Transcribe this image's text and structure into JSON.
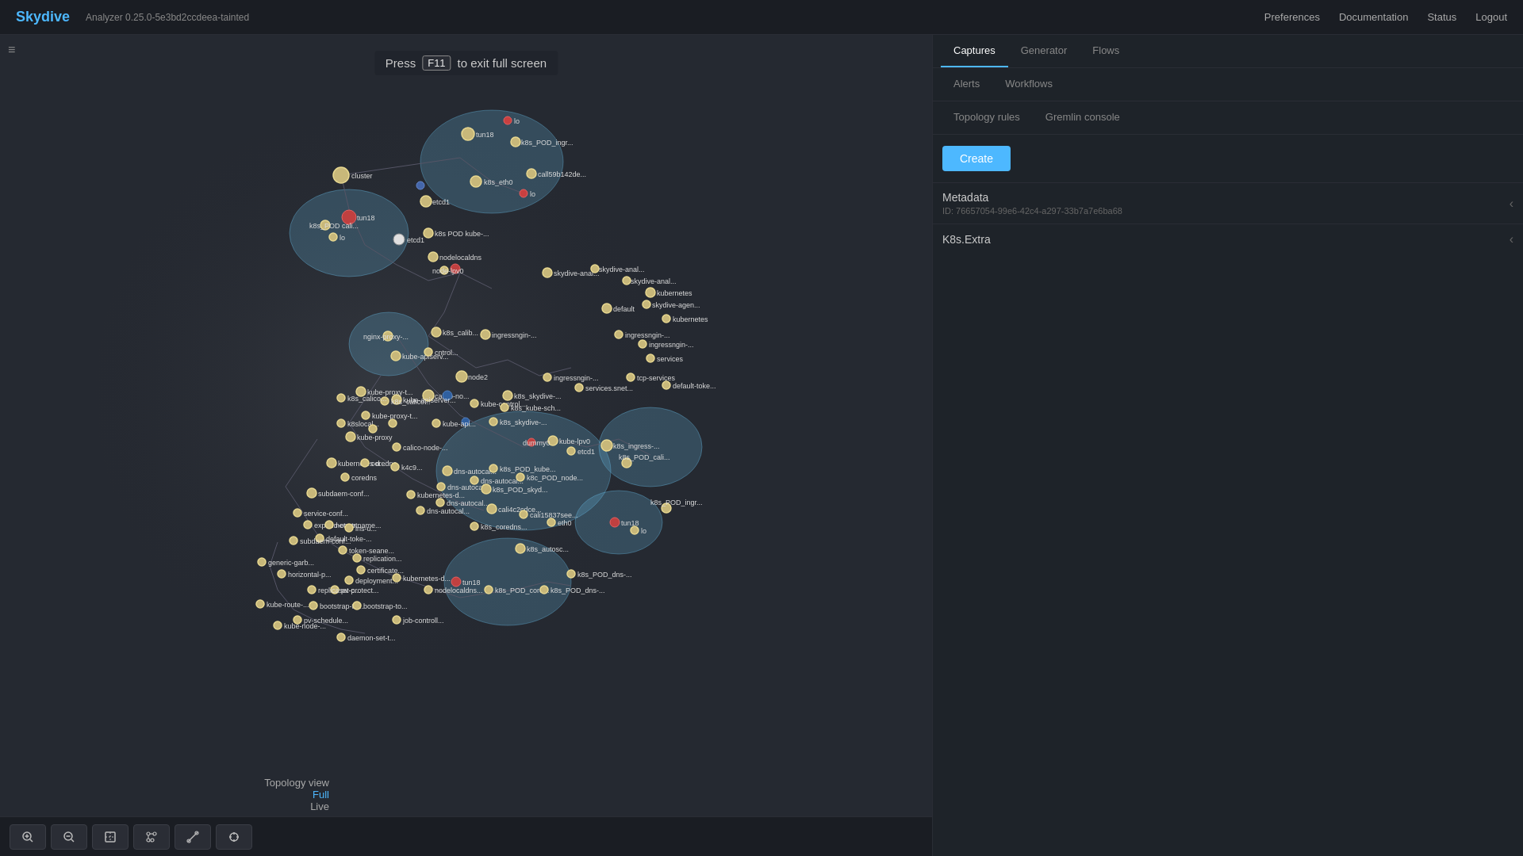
{
  "app": {
    "brand": "Skydive",
    "subtitle": "Analyzer 0.25.0-5e3bd2ccdeea-tainted",
    "fullscreen_notice": {
      "press": "Press",
      "key": "F11",
      "action": "to exit full screen"
    }
  },
  "topnav": {
    "links": [
      {
        "label": "Preferences",
        "name": "preferences-link"
      },
      {
        "label": "Documentation",
        "name": "documentation-link"
      },
      {
        "label": "Status",
        "name": "status-link"
      },
      {
        "label": "Logout",
        "name": "logout-link"
      }
    ]
  },
  "right_panel": {
    "tabs_row1": [
      {
        "label": "Captures",
        "active": true,
        "name": "captures-tab"
      },
      {
        "label": "Generator",
        "active": false,
        "name": "generator-tab"
      },
      {
        "label": "Flows",
        "active": false,
        "name": "flows-tab"
      }
    ],
    "tabs_row2": [
      {
        "label": "Alerts",
        "active": false,
        "name": "alerts-tab"
      },
      {
        "label": "Workflows",
        "active": false,
        "name": "workflows-tab"
      }
    ],
    "tabs_row3": [
      {
        "label": "Topology rules",
        "active": false,
        "name": "topology-rules-tab"
      },
      {
        "label": "Gremlin console",
        "active": false,
        "name": "gremlin-console-tab"
      }
    ],
    "create_button": "Create",
    "metadata": {
      "title": "Metadata",
      "id_label": "ID: 76657054-99e6-42c4-a297-33b7a7e6ba68"
    },
    "k8s_extra": {
      "title": "K8s.Extra"
    }
  },
  "bottom_toolbar": {
    "buttons": [
      {
        "icon": "🔍+",
        "name": "zoom-in-button",
        "label": "Zoom In"
      },
      {
        "icon": "🔍-",
        "name": "zoom-out-button",
        "label": "Zoom Out"
      },
      {
        "icon": "⊡",
        "name": "fit-button",
        "label": "Fit"
      },
      {
        "icon": "⊞⚙",
        "name": "layout-settings-button",
        "label": "Layout Settings"
      },
      {
        "icon": "↔⚙",
        "name": "edge-settings-button",
        "label": "Edge Settings"
      },
      {
        "icon": "⊕⚙",
        "name": "node-settings-button",
        "label": "Node Settings"
      }
    ]
  },
  "topology_view": {
    "label": "Topology view",
    "full": "Full",
    "live": "Live"
  },
  "filter_icon": "≡"
}
